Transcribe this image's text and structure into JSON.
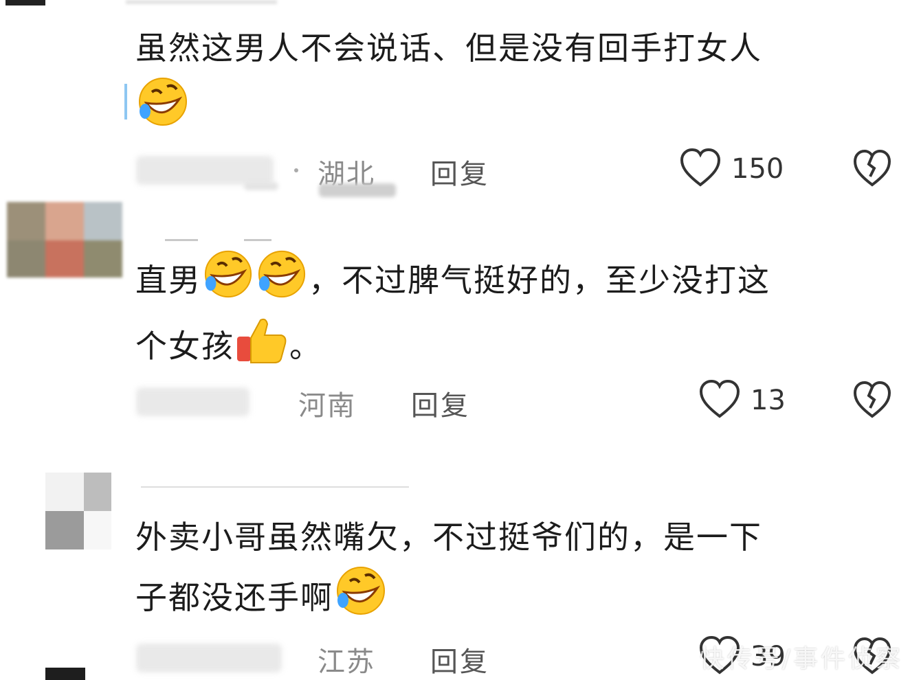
{
  "comments": [
    {
      "text": "虽然这男人不会说话、但是没有回手打女人",
      "location": "湖北",
      "reply_label": "回复",
      "like_count": "150"
    },
    {
      "text_part1": "直男",
      "text_part2": "，不过脾气挺好的，至少没打这",
      "text_part3": "个女孩",
      "text_part4": "。",
      "location": "河南",
      "reply_label": "回复",
      "like_count": "13"
    },
    {
      "text_part1": "外卖小哥虽然嘴欠，不过挺爷们的，是一下",
      "text_part2": "子都没还手啊",
      "location": "江苏",
      "reply_label": "回复",
      "like_count": "39"
    }
  ],
  "icons": {
    "like": "heart-outline-icon",
    "dislike": "broken-heart-icon",
    "emoji_laugh": "rofl-emoji",
    "emoji_thumb": "thumbs-up-emoji"
  },
  "colors": {
    "text": "#1c1c1c",
    "meta": "#8a8a8a",
    "emoji_yellow": "#FFC928",
    "thumb_red": "#E84C3D"
  },
  "watermark": "快传号/事件侦察"
}
